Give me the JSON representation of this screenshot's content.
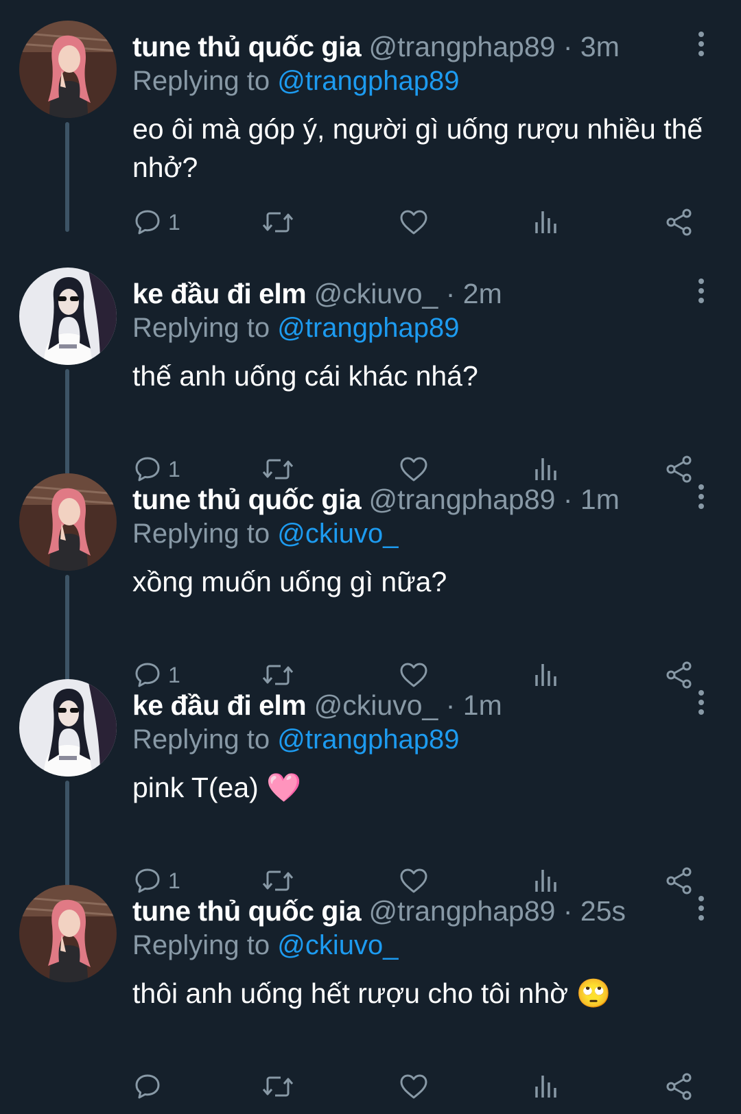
{
  "tweets": [
    {
      "name": "tune thủ quốc gia",
      "handle": "@trangphap89",
      "dot": "·",
      "time": "3m",
      "reply_prefix": "Replying to",
      "reply_to": "@trangphap89",
      "text": "eo ôi mà góp ý, người gì uống rượu nhiều thế nhở?",
      "reply_count": "1",
      "avatar": "pink-hair-avatar"
    },
    {
      "name": "ke đầu đi elm",
      "handle": "@ckiuvo_",
      "dot": "·",
      "time": "2m",
      "reply_prefix": "Replying to",
      "reply_to": "@trangphap89",
      "text": "thế anh uống cái khác nhá?",
      "reply_count": "1",
      "avatar": "dark-hair-avatar"
    },
    {
      "name": "tune thủ quốc gia",
      "handle": "@trangphap89",
      "dot": "·",
      "time": "1m",
      "reply_prefix": "Replying to",
      "reply_to": "@ckiuvo_",
      "text": "xồng muốn uống gì nữa?",
      "reply_count": "1",
      "avatar": "pink-hair-avatar"
    },
    {
      "name": "ke đầu đi elm",
      "handle": "@ckiuvo_",
      "dot": "·",
      "time": "1m",
      "reply_prefix": "Replying to",
      "reply_to": "@trangphap89",
      "text": "pink T(ea) 🩷",
      "reply_count": "1",
      "avatar": "dark-hair-avatar"
    },
    {
      "name": "tune thủ quốc gia",
      "handle": "@trangphap89",
      "dot": "·",
      "time": "25s",
      "reply_prefix": "Replying to",
      "reply_to": "@ckiuvo_",
      "text": "thôi anh uống hết rượu cho tôi nhờ 🙄",
      "reply_count": "",
      "avatar": "pink-hair-avatar"
    }
  ],
  "colors": {
    "background": "#15202b",
    "secondary_text": "#8899a6",
    "link": "#1d9bf0",
    "thread_line": "#3d5466"
  },
  "icons": [
    "reply-icon",
    "retweet-icon",
    "like-icon",
    "views-icon",
    "share-icon",
    "more-icon"
  ]
}
